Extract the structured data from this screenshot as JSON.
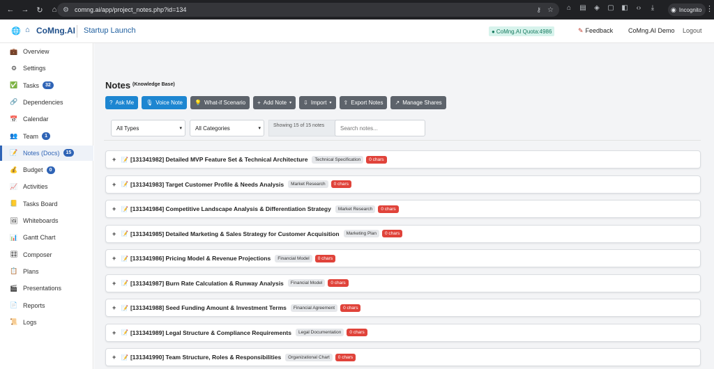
{
  "browser": {
    "url": "comng.ai/app/project_notes.php?id=134",
    "incognito_label": "Incognito"
  },
  "header": {
    "brand": "CoMng.AI",
    "project": "Startup Launch",
    "quota": "CoMng.AI Quota:4986",
    "feedback": "Feedback",
    "user": "CoMng.AI Demo",
    "logout": "Logout"
  },
  "sidebar": {
    "items": [
      {
        "label": "Overview",
        "icon": "briefcase-icon",
        "glyph": "💼"
      },
      {
        "label": "Settings",
        "icon": "gear-icon",
        "glyph": "⚙"
      },
      {
        "label": "Tasks",
        "icon": "check-icon",
        "glyph": "✅",
        "badge": "32"
      },
      {
        "label": "Dependencies",
        "icon": "link-icon",
        "glyph": "🔗"
      },
      {
        "label": "Calendar",
        "icon": "calendar-icon",
        "glyph": "📅"
      },
      {
        "label": "Team",
        "icon": "team-icon",
        "glyph": "👥",
        "badge": "1"
      },
      {
        "label": "Notes (Docs)",
        "icon": "notes-icon",
        "glyph": "📝",
        "badge": "15",
        "active": true
      },
      {
        "label": "Budget",
        "icon": "money-bag-icon",
        "glyph": "💰",
        "badge": "0"
      },
      {
        "label": "Activities",
        "icon": "chart-icon",
        "glyph": "📈"
      },
      {
        "label": "Tasks Board",
        "icon": "sticky-note-icon",
        "glyph": "📒"
      },
      {
        "label": "Whiteboards",
        "icon": "whiteboard-icon",
        "glyph": "🖼"
      },
      {
        "label": "Gantt Chart",
        "icon": "gantt-icon",
        "glyph": "📊"
      },
      {
        "label": "Composer",
        "icon": "composer-icon",
        "glyph": "🎛"
      },
      {
        "label": "Plans",
        "icon": "plans-icon",
        "glyph": "📋"
      },
      {
        "label": "Presentations",
        "icon": "presentation-icon",
        "glyph": "🎬"
      },
      {
        "label": "Reports",
        "icon": "reports-icon",
        "glyph": "📄"
      },
      {
        "label": "Logs",
        "icon": "logs-icon",
        "glyph": "📜"
      }
    ]
  },
  "page": {
    "title": "Notes",
    "subtitle": "(Knowledge Base)"
  },
  "toolbar": {
    "buttons": [
      {
        "label": "Ask Me",
        "icon": "question-icon",
        "glyph": "?",
        "style": "blue"
      },
      {
        "label": "Voice Note",
        "icon": "microphone-icon",
        "glyph": "🎙",
        "style": "blue"
      },
      {
        "label": "What-if Scenario",
        "icon": "lightbulb-icon",
        "glyph": "💡",
        "style": "gray"
      },
      {
        "label": "Add Note",
        "icon": "plus-icon",
        "glyph": "+",
        "style": "gray",
        "dropdown": true
      },
      {
        "label": "Import",
        "icon": "import-icon",
        "glyph": "⇩",
        "style": "gray",
        "dropdown": true
      },
      {
        "label": "Export Notes",
        "icon": "export-icon",
        "glyph": "⇧",
        "style": "gray"
      },
      {
        "label": "Manage Shares",
        "icon": "share-icon",
        "glyph": "↗",
        "style": "gray"
      }
    ]
  },
  "filters": {
    "types": "All Types",
    "categories": "All Categories",
    "showing": "Showing 15 of 15 notes",
    "search_placeholder": "Search notes..."
  },
  "notes": [
    {
      "title": "[131341982] Detailed MVP Feature Set & Technical Architecture",
      "tag": "Technical Specification",
      "chars": "0 chars"
    },
    {
      "title": "[131341983] Target Customer Profile & Needs Analysis",
      "tag": "Market Research",
      "chars": "0 chars"
    },
    {
      "title": "[131341984] Competitive Landscape Analysis & Differentiation Strategy",
      "tag": "Market Research",
      "chars": "0 chars"
    },
    {
      "title": "[131341985] Detailed Marketing & Sales Strategy for Customer Acquisition",
      "tag": "Marketing Plan",
      "chars": "0 chars"
    },
    {
      "title": "[131341986] Pricing Model & Revenue Projections",
      "tag": "Financial Model",
      "chars": "0 chars"
    },
    {
      "title": "[131341987] Burn Rate Calculation & Runway Analysis",
      "tag": "Financial Model",
      "chars": "0 chars"
    },
    {
      "title": "[131341988] Seed Funding Amount & Investment Terms",
      "tag": "Financial Agreement",
      "chars": "0 chars"
    },
    {
      "title": "[131341989] Legal Structure & Compliance Requirements",
      "tag": "Legal Documentation",
      "chars": "0 chars"
    },
    {
      "title": "[131341990] Team Structure, Roles & Responsibilities",
      "tag": "Organizational Chart",
      "chars": "0 chars"
    }
  ]
}
